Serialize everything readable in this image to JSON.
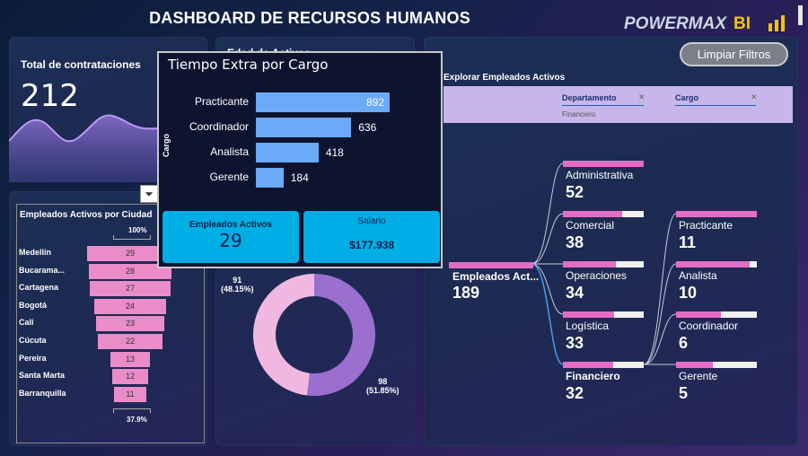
{
  "header": {
    "title": "DASHBOARD DE RECURSOS HUMANOS",
    "brand_name": "POWERMAX",
    "brand_bi": "BI",
    "brand_color": "#f5c400"
  },
  "kpi_contrataciones": {
    "label": "Total de contrataciones",
    "value": "212"
  },
  "edad_card": {
    "title": "Edad de Activos"
  },
  "funnel": {
    "title": "Empleados Activos por Ciudad",
    "top_pct": "100%",
    "bottom_pct": "37.9%",
    "rows": [
      {
        "city": "Medellín",
        "value": "29"
      },
      {
        "city": "Bucarama...",
        "value": "28"
      },
      {
        "city": "Cartagena",
        "value": "27"
      },
      {
        "city": "Bogotá",
        "value": "24"
      },
      {
        "city": "Cali",
        "value": "23"
      },
      {
        "city": "Cúcuta",
        "value": "22"
      },
      {
        "city": "Pereira",
        "value": "13"
      },
      {
        "city": "Santa Marta",
        "value": "12"
      },
      {
        "city": "Barranquilla",
        "value": "11"
      }
    ]
  },
  "donut": {
    "segments": [
      {
        "value": "91",
        "pct": "(48.15%)",
        "color": "#f0b8e0"
      },
      {
        "value": "98",
        "pct": "(51.85%)",
        "color": "#9a6fd0"
      }
    ]
  },
  "popup": {
    "title": "Tiempo Extra por Cargo",
    "axis_label": "Cargo",
    "bars": [
      {
        "label": "Practicante",
        "value": "892"
      },
      {
        "label": "Coordinador",
        "value": "636"
      },
      {
        "label": "Analista",
        "value": "418"
      },
      {
        "label": "Gerente",
        "value": "184"
      }
    ],
    "card1": {
      "label": "Empleados Activos",
      "value": "29"
    },
    "card2": {
      "label": "Salario",
      "value": "$177.938"
    }
  },
  "filters": {
    "clear_label": "Limpiar Filtros",
    "explore_title": "Explorar Empleados Activos",
    "slicer_dept_title": "Departamento",
    "slicer_dept_value": "Financiero",
    "slicer_cargo_title": "Cargo"
  },
  "decomp": {
    "root": {
      "label": "Empleados Act...",
      "value": "189"
    },
    "departments": [
      {
        "label": "Administrativa",
        "value": "52",
        "fill": 1.0
      },
      {
        "label": "Comercial",
        "value": "38",
        "fill": 0.73
      },
      {
        "label": "Operaciones",
        "value": "34",
        "fill": 0.65
      },
      {
        "label": "Logística",
        "value": "33",
        "fill": 0.63
      },
      {
        "label": "Financiero",
        "value": "32",
        "fill": 0.62
      }
    ],
    "roles": [
      {
        "label": "Practicante",
        "value": "11",
        "fill": 1.0
      },
      {
        "label": "Analista",
        "value": "10",
        "fill": 0.91
      },
      {
        "label": "Coordinador",
        "value": "6",
        "fill": 0.55
      },
      {
        "label": "Gerente",
        "value": "5",
        "fill": 0.45
      }
    ]
  }
}
